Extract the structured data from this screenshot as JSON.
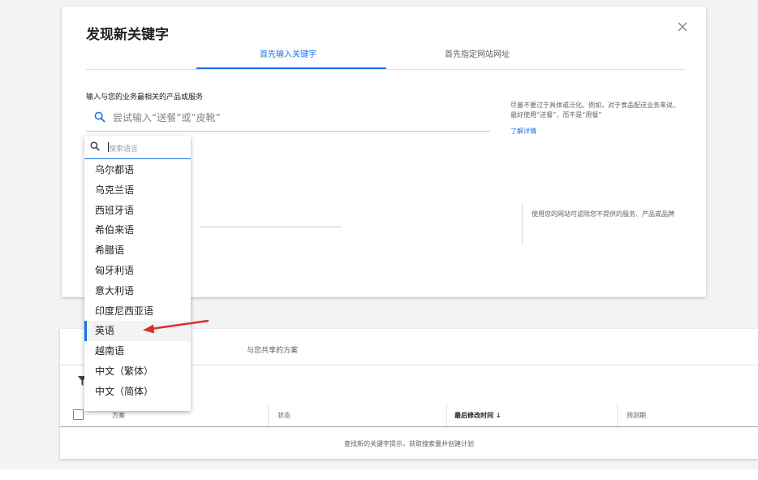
{
  "modal": {
    "title": "发现新关键字",
    "tabs": [
      {
        "label": "首先输入关键字",
        "active": true
      },
      {
        "label": "首先指定网站网址",
        "active": false
      }
    ],
    "product_label": "输入与您的业务最相关的产品或服务",
    "search_placeholder": "尝试输入“送餐”或“皮靴”",
    "hint_text": "尽量不要过于具体或泛化。例如，对于食品配送业务来说，最好使用“送餐”，而不是“用餐”",
    "learn_more": "了解详情",
    "site_hint": "使用您的网站可滤除您不提供的服务、产品或品牌"
  },
  "language_dropdown": {
    "search_placeholder": "搜索语言",
    "items": [
      {
        "label": "乌尔都语"
      },
      {
        "label": "乌克兰语"
      },
      {
        "label": "西班牙语"
      },
      {
        "label": "希伯来语"
      },
      {
        "label": "希腊语"
      },
      {
        "label": "匈牙利语"
      },
      {
        "label": "意大利语"
      },
      {
        "label": "印度尼西亚语"
      },
      {
        "label": "英语",
        "selected": true
      },
      {
        "label": "越南语"
      },
      {
        "label": "中文（繁体）"
      },
      {
        "label": "中文（简体）"
      }
    ]
  },
  "plans_panel": {
    "shared_tab": "与您共享的方案",
    "columns": [
      "方案",
      "状态",
      "最后修改时间 ↓",
      "预测期"
    ],
    "empty_text": "查找新的关键字提示，获取搜索量并创建计划"
  },
  "colors": {
    "accent": "#1a73e8",
    "annotation_arrow": "#d93025"
  }
}
